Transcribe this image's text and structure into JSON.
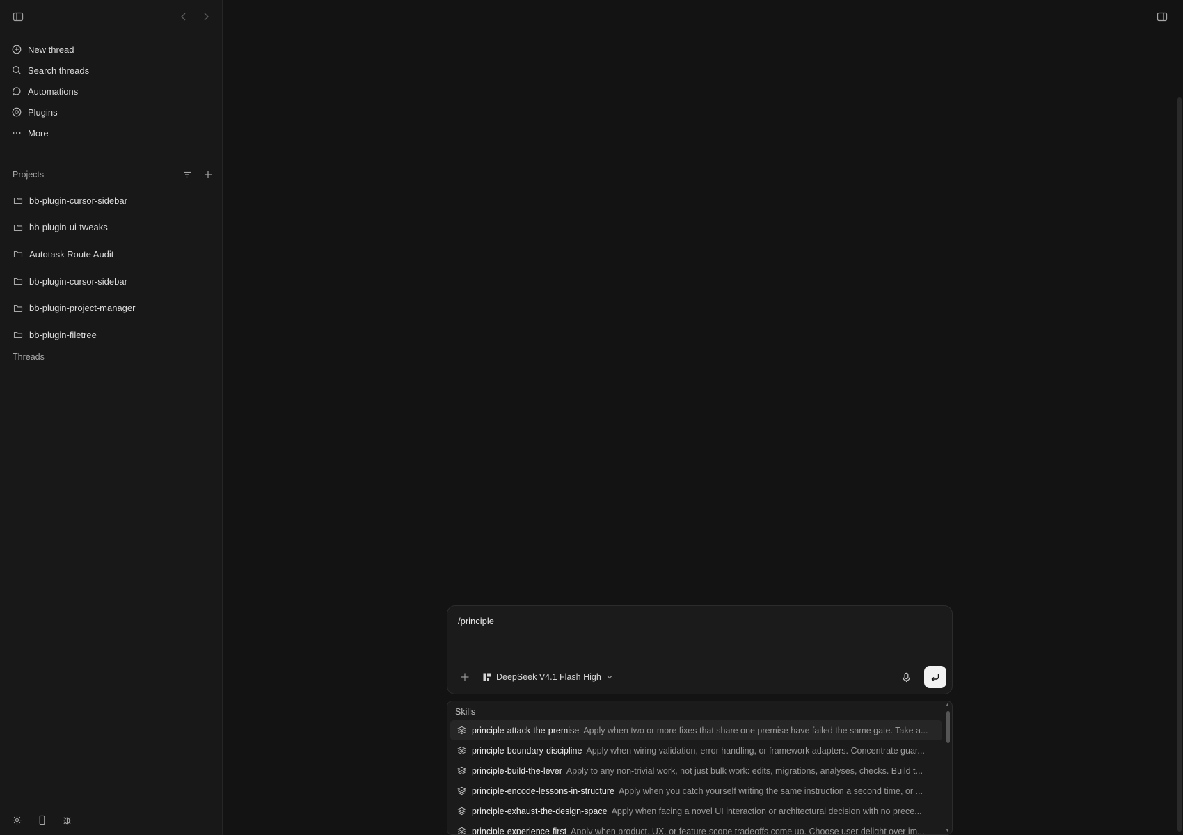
{
  "sidebar": {
    "nav": [
      {
        "label": "New thread",
        "icon": "plus-circle-icon"
      },
      {
        "label": "Search threads",
        "icon": "search-icon"
      },
      {
        "label": "Automations",
        "icon": "automations-icon"
      },
      {
        "label": "Plugins",
        "icon": "plugins-icon"
      },
      {
        "label": "More",
        "icon": "more-icon"
      }
    ],
    "projects_title": "Projects",
    "projects": [
      "bb-plugin-cursor-sidebar",
      "bb-plugin-ui-tweaks",
      "Autotask Route Audit",
      "bb-plugin-cursor-sidebar",
      "bb-plugin-project-manager",
      "bb-plugin-filetree"
    ],
    "threads_title": "Threads"
  },
  "composer": {
    "input_value": "/principle",
    "model_label": "DeepSeek V4.1 Flash High"
  },
  "skills": {
    "title": "Skills",
    "items": [
      {
        "name": "principle-attack-the-premise",
        "desc": "Apply when two or more fixes that share one premise have failed the same gate. Take a..."
      },
      {
        "name": "principle-boundary-discipline",
        "desc": "Apply when wiring validation, error handling, or framework adapters. Concentrate guar..."
      },
      {
        "name": "principle-build-the-lever",
        "desc": "Apply to any non-trivial work, not just bulk work: edits, migrations, analyses, checks. Build t..."
      },
      {
        "name": "principle-encode-lessons-in-structure",
        "desc": "Apply when you catch yourself writing the same instruction a second time, or ..."
      },
      {
        "name": "principle-exhaust-the-design-space",
        "desc": "Apply when facing a novel UI interaction or architectural decision with no prece..."
      },
      {
        "name": "principle-experience-first",
        "desc": "Apply when product, UX, or feature-scope tradeoffs come up. Choose user delight over im..."
      }
    ]
  },
  "colors": {
    "background": "#131313",
    "sidebar": "#181818",
    "send_button": "#f2f2f2"
  }
}
